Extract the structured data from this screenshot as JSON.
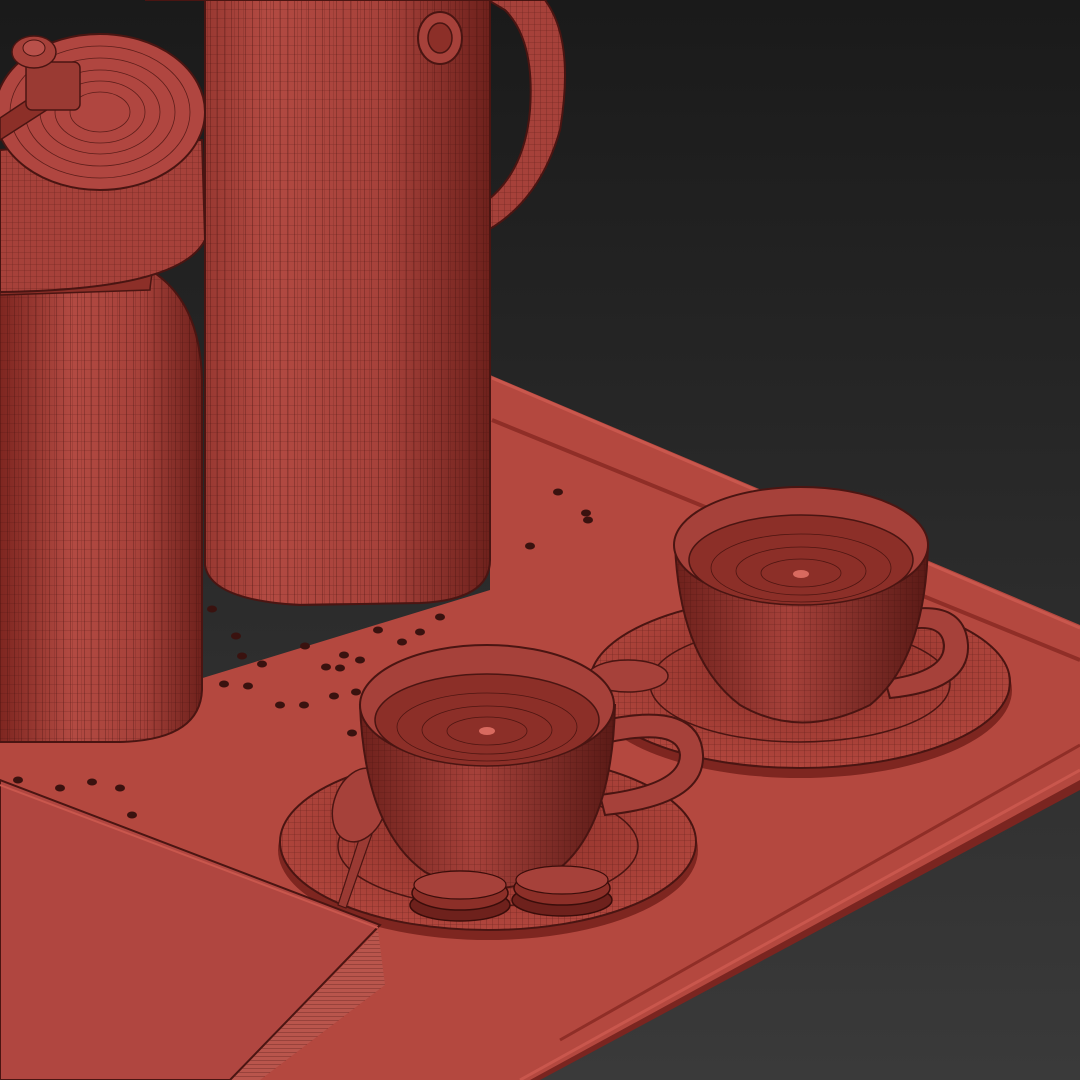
{
  "scene": {
    "subject": "wireframe-coffee-set",
    "colors": {
      "background_top": "#1a1a1a",
      "background_bottom": "#3a3a3a",
      "tray_top": "#b4483f",
      "tray_edge": "#8f2e27",
      "tray_side": "#9a3229",
      "object_base": "#a6413a",
      "object_shadow": "#6e211c",
      "object_dark": "#4a1512",
      "wire": "#3a0d0a",
      "coffee_bean": "#3a120f",
      "coffee_inner": "#8c2f28"
    },
    "objects": [
      "coffee-pot",
      "grinder-jar",
      "cup-front",
      "cup-back",
      "saucer-front",
      "saucer-back",
      "spoon-front",
      "spoon-back",
      "macaron-left",
      "macaron-right",
      "book",
      "coffee-beans"
    ]
  }
}
